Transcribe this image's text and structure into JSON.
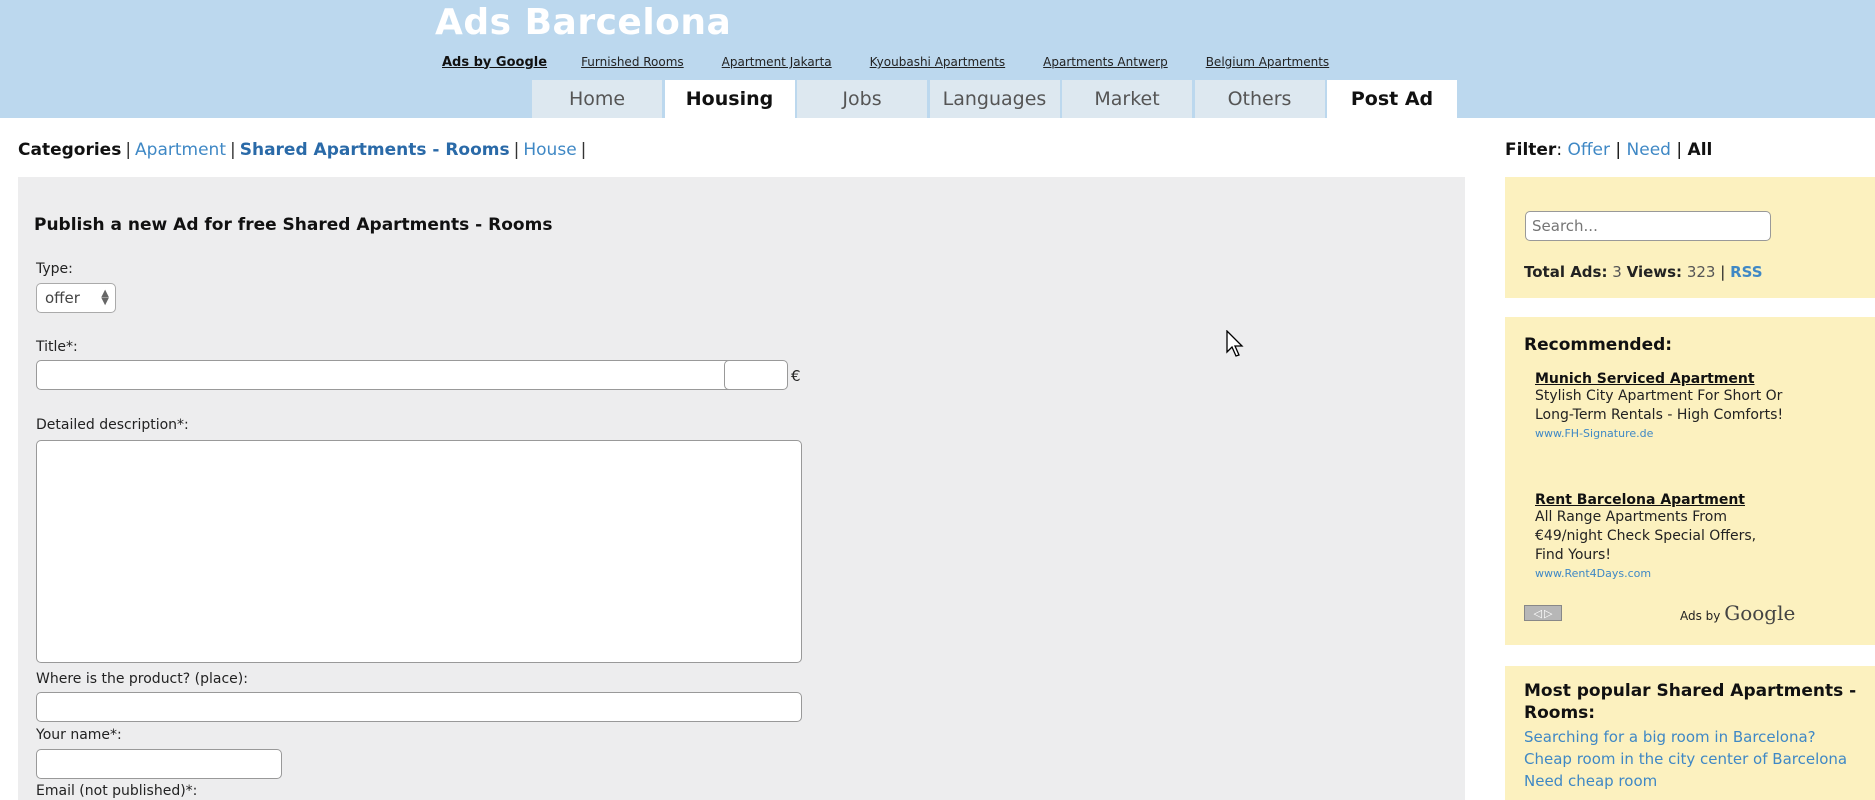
{
  "header": {
    "site_title": "Ads Barcelona",
    "ads_by_google": "Ads by Google",
    "ad_links": [
      "Furnished Rooms",
      "Apartment Jakarta",
      "Kyoubashi Apartments",
      "Apartments Antwerp",
      "Belgium Apartments"
    ]
  },
  "tabs": [
    {
      "label": "Home"
    },
    {
      "label": "Housing"
    },
    {
      "label": "Jobs"
    },
    {
      "label": "Languages"
    },
    {
      "label": "Market"
    },
    {
      "label": "Others"
    },
    {
      "label": "Post Ad"
    }
  ],
  "categories": {
    "label": "Categories",
    "items": [
      "Apartment",
      "Shared Apartments - Rooms",
      "House"
    ]
  },
  "form": {
    "title": "Publish a new Ad for free Shared Apartments - Rooms",
    "type_label": "Type:",
    "type_value": "offer",
    "title_label": "Title*:",
    "currency": "€",
    "description_label": "Detailed description*:",
    "place_label": "Where is the product? (place):",
    "name_label": "Your name*:",
    "email_label": "Email (not published)*:"
  },
  "filter": {
    "label": "Filter",
    "offer": "Offer",
    "need": "Need",
    "all": "All"
  },
  "search": {
    "placeholder": "Search..."
  },
  "stats": {
    "total_ads_label": "Total Ads:",
    "total_ads": "3",
    "views_label": "Views:",
    "views": "323",
    "rss": "RSS"
  },
  "recommended": {
    "title": "Recommended:",
    "ads": [
      {
        "title": "Munich Serviced Apartment",
        "desc": "Stylish City Apartment For Short Or Long-Term Rentals - High Comforts!",
        "url": "www.FH-Signature.de"
      },
      {
        "title": "Rent Barcelona Apartment",
        "desc": "All Range Apartments From €49/night Check Special Offers, Find Yours!",
        "url": "www.Rent4Days.com"
      }
    ],
    "ads_by": "Ads by",
    "google": "Google"
  },
  "popular": {
    "title": "Most popular Shared Apartments - Rooms:",
    "links": [
      "Searching for a big room in Barcelona?",
      "Cheap room in the city center of Barcelona",
      "Need cheap room"
    ]
  }
}
